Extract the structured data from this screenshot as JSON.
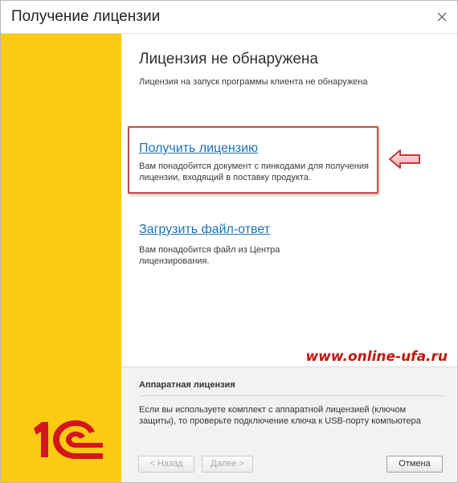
{
  "window": {
    "title": "Получение лицензии",
    "close_icon": "close-icon"
  },
  "main": {
    "heading": "Лицензия не обнаружена",
    "subheading": "Лицензия на запуск программы клиента не обнаружена"
  },
  "options": [
    {
      "link": "Получить лицензию",
      "description_line1": "Вам понадобится документ с пинкодами для получения",
      "description_line2": "лицензии, входящий в поставку продукта."
    },
    {
      "link": "Загрузить файл-ответ",
      "description_line1": "Вам понадобится файл из Центра",
      "description_line2": "лицензирования."
    }
  ],
  "annotation": {
    "arrow_icon": "left-arrow-icon",
    "highlight_color": "#c84a4a"
  },
  "watermark": "www.online-ufa.ru",
  "hardware": {
    "title": "Аппаратная лицензия",
    "description": "Если вы используете комплект с аппаратной лицензией (ключом защиты), то проверьте подключение ключа к USB-порту компьютера"
  },
  "buttons": {
    "back": "< Назад",
    "next": "Далее >",
    "cancel": "Отмена"
  },
  "brand": {
    "logo_text": "1С",
    "sidebar_color": "#fbcb14",
    "logo_color": "#d3151c"
  }
}
